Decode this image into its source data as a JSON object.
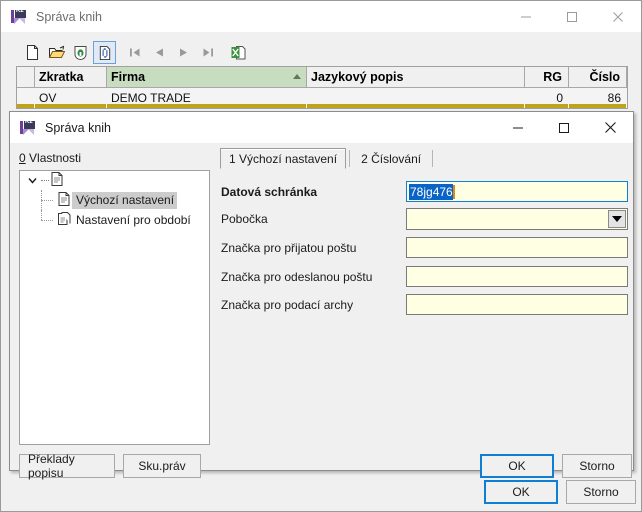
{
  "outer_window": {
    "title": "Správa knih",
    "icon": "k2-app-icon",
    "controls": {
      "minimize": "minimize-icon",
      "maximize": "maximize-icon",
      "close": "close-icon"
    },
    "toolbar": [
      {
        "name": "new-record-button",
        "icon": "new-document-icon",
        "pressed": false
      },
      {
        "name": "open-record-button",
        "icon": "open-folder-icon",
        "pressed": false
      },
      {
        "name": "save-record-button",
        "icon": "save-lock-icon",
        "pressed": false
      },
      {
        "name": "refresh-button",
        "icon": "refresh-document-icon",
        "pressed": true
      },
      {
        "name": "first-record-button",
        "icon": "nav-first-icon",
        "pressed": false
      },
      {
        "name": "previous-record-button",
        "icon": "nav-previous-icon",
        "pressed": false
      },
      {
        "name": "next-record-button",
        "icon": "nav-next-icon",
        "pressed": false
      },
      {
        "name": "last-record-button",
        "icon": "nav-last-icon",
        "pressed": false
      },
      {
        "name": "export-excel-button",
        "icon": "excel-export-icon",
        "pressed": false
      }
    ],
    "grid": {
      "columns": [
        {
          "label": "",
          "align": "left",
          "sorted": false
        },
        {
          "label": "Zkratka",
          "align": "left",
          "sorted": false
        },
        {
          "label": "Firma",
          "align": "left",
          "sorted": true,
          "sort_direction": "ascending"
        },
        {
          "label": "Jazykový popis",
          "align": "left",
          "sorted": false
        },
        {
          "label": "RG",
          "align": "right",
          "sorted": false
        },
        {
          "label": "Číslo",
          "align": "right",
          "sorted": false
        }
      ],
      "rows": [
        {
          "marker": "",
          "zkratka": "OV",
          "firma": "DEMO TRADE",
          "jazykovy_popis": "",
          "rg": "0",
          "cislo": "86"
        }
      ]
    },
    "buttons": {
      "ok": "OK",
      "storno": "Storno"
    }
  },
  "dialog": {
    "title": "Správa knih",
    "icon": "k2-app-icon",
    "controls": {
      "minimize": "minimize-icon",
      "maximize": "maximize-icon",
      "close": "close-icon"
    },
    "tree": {
      "label_accel": "0",
      "label_rest": " Vlastnosti",
      "root": {
        "icon": "document-icon",
        "label": "",
        "expanded": true
      },
      "items": [
        {
          "label": "Výchozí nastavení",
          "icon": "document-icon",
          "selected": true
        },
        {
          "label": "Nastavení pro období",
          "icon": "documents-icon",
          "selected": false
        }
      ]
    },
    "tabs": [
      {
        "label": "1 Výchozí nastavení",
        "active": true
      },
      {
        "label": "2 Číslování",
        "active": false
      }
    ],
    "form": {
      "fields": [
        {
          "label": "Datová schránka",
          "bold": true,
          "type": "text",
          "value": "78jg476",
          "selected": true,
          "focused": true,
          "placeholder": ""
        },
        {
          "label": "Pobočka",
          "bold": false,
          "type": "combobox",
          "value": "",
          "selected": false,
          "focused": false,
          "placeholder": ""
        },
        {
          "label": "Značka pro přijatou poštu",
          "bold": false,
          "type": "text",
          "value": "",
          "selected": false,
          "focused": false,
          "placeholder": ""
        },
        {
          "label": "Značka pro odeslanou poštu",
          "bold": false,
          "type": "text",
          "value": "",
          "selected": false,
          "focused": false,
          "placeholder": ""
        },
        {
          "label": "Značka pro podací archy",
          "bold": false,
          "type": "text",
          "value": "",
          "selected": false,
          "focused": false,
          "placeholder": ""
        }
      ]
    },
    "buttons": {
      "preklady_popisu": "Překlady popisu",
      "sku_prav": "Sku.práv",
      "ok": "OK",
      "storno": "Storno"
    }
  },
  "colors": {
    "accent_focus": "#0f7fd4",
    "selection": "#0a64c8",
    "caret": "#e08a10",
    "sorted_header": "#c8ddc0",
    "field_background": "#ffffe4",
    "selected_row": "#bfa31b",
    "window_background": "#f0f0f0"
  }
}
